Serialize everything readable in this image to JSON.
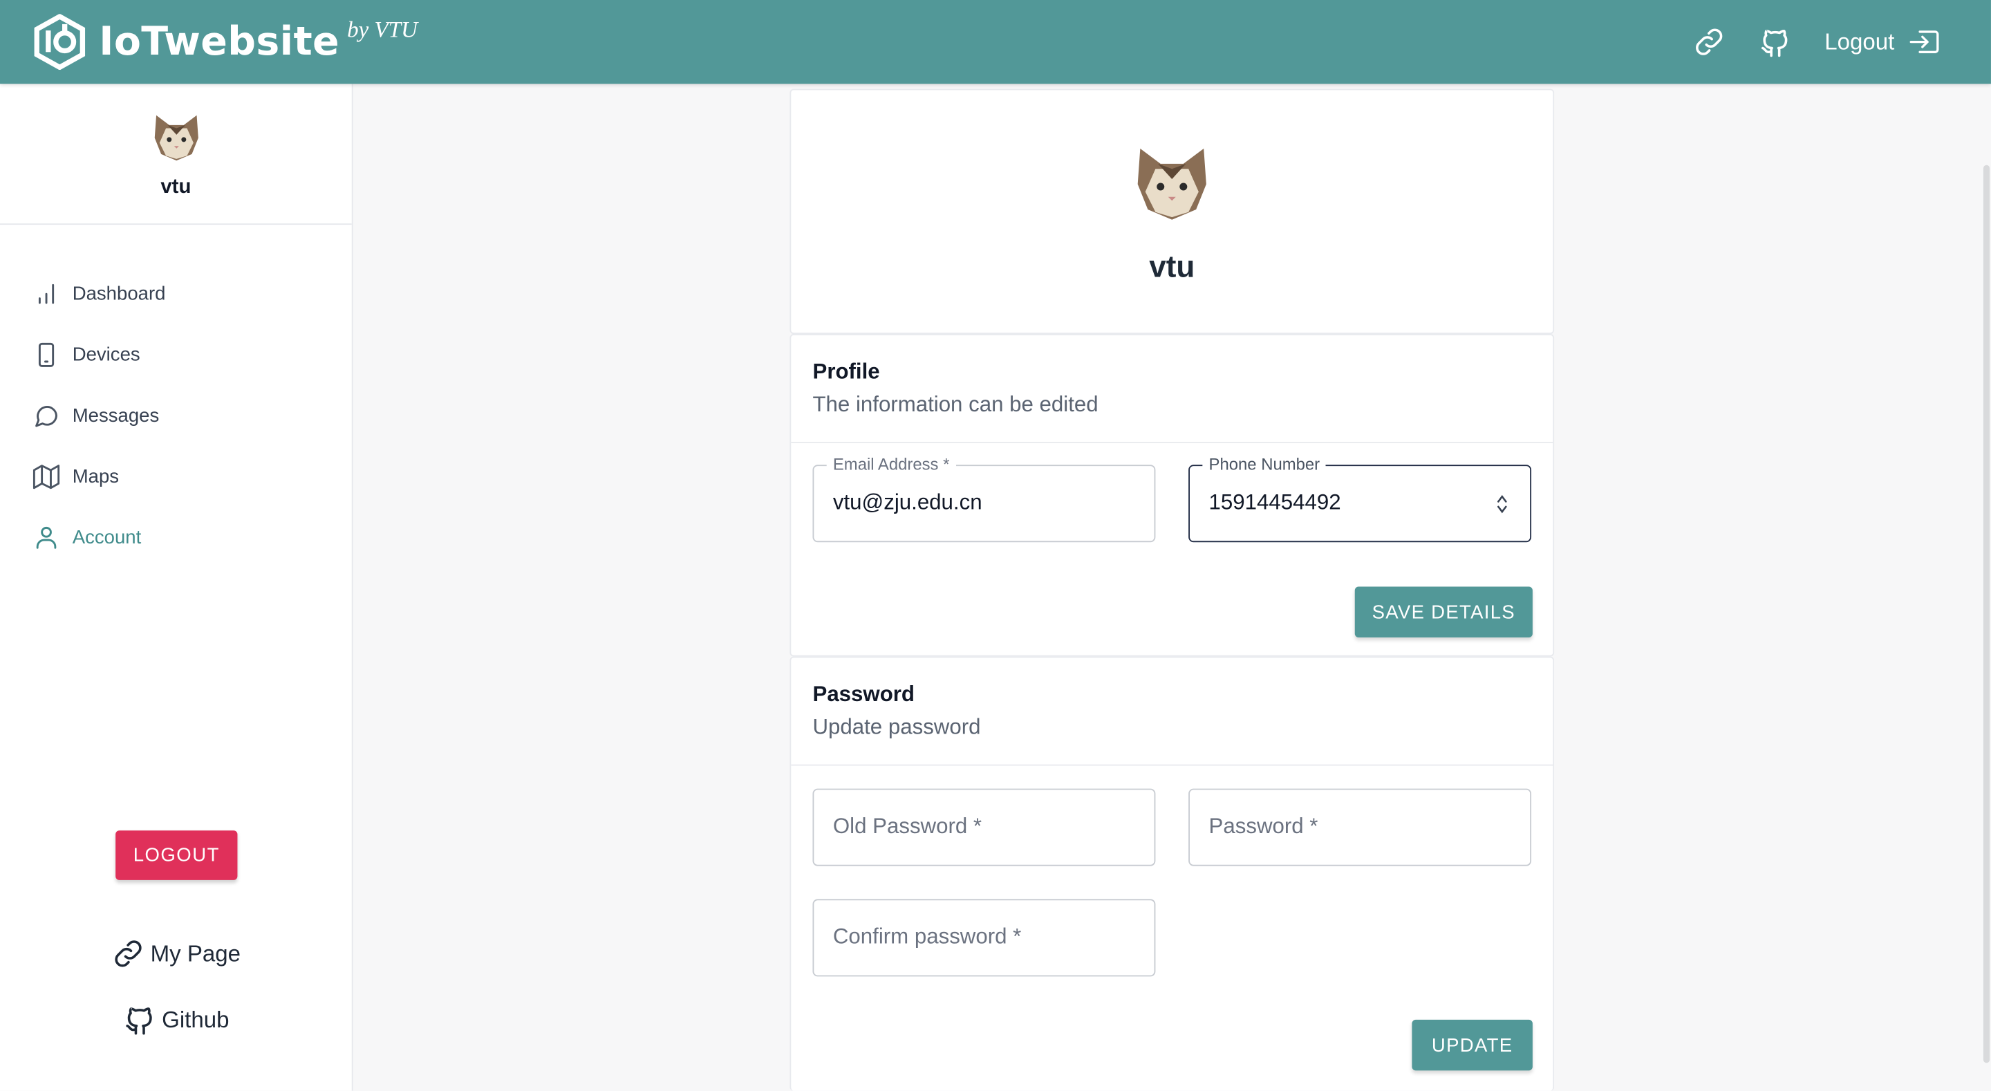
{
  "brand": {
    "name": "IoTwebsite",
    "by": "by VTU"
  },
  "topbar": {
    "logout_label": "Logout"
  },
  "sidebar": {
    "username": "vtu",
    "items": [
      {
        "label": "Dashboard",
        "icon": "bar-chart-icon"
      },
      {
        "label": "Devices",
        "icon": "tablet-icon"
      },
      {
        "label": "Messages",
        "icon": "message-circle-icon"
      },
      {
        "label": "Maps",
        "icon": "map-icon"
      },
      {
        "label": "Account",
        "icon": "user-icon",
        "active": true
      }
    ],
    "logout_button": "LOGOUT",
    "my_page": "My Page",
    "github": "Github"
  },
  "account": {
    "username": "vtu"
  },
  "profile": {
    "title": "Profile",
    "subtitle": "The information can be edited",
    "email_label": "Email Address *",
    "email_value": "vtu@zju.edu.cn",
    "phone_label": "Phone Number",
    "phone_value": "15914454492",
    "save_button": "SAVE DETAILS"
  },
  "password": {
    "title": "Password",
    "subtitle": "Update password",
    "old_placeholder": "Old Password *",
    "new_placeholder": "Password *",
    "confirm_placeholder": "Confirm password *",
    "update_button": "UPDATE"
  },
  "colors": {
    "primary": "#529898",
    "danger": "#e0305a",
    "active_nav": "#3f8b8b"
  }
}
